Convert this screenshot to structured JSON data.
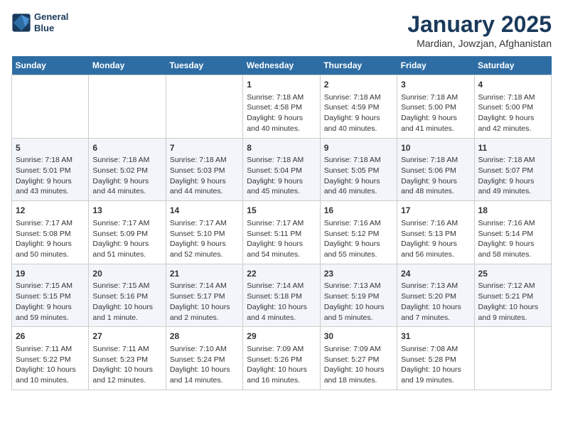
{
  "logo": {
    "line1": "General",
    "line2": "Blue"
  },
  "title": "January 2025",
  "subtitle": "Mardian, Jowzjan, Afghanistan",
  "days_of_week": [
    "Sunday",
    "Monday",
    "Tuesday",
    "Wednesday",
    "Thursday",
    "Friday",
    "Saturday"
  ],
  "weeks": [
    [
      {
        "num": "",
        "info": ""
      },
      {
        "num": "",
        "info": ""
      },
      {
        "num": "",
        "info": ""
      },
      {
        "num": "1",
        "info": "Sunrise: 7:18 AM\nSunset: 4:58 PM\nDaylight: 9 hours and 40 minutes."
      },
      {
        "num": "2",
        "info": "Sunrise: 7:18 AM\nSunset: 4:59 PM\nDaylight: 9 hours and 40 minutes."
      },
      {
        "num": "3",
        "info": "Sunrise: 7:18 AM\nSunset: 5:00 PM\nDaylight: 9 hours and 41 minutes."
      },
      {
        "num": "4",
        "info": "Sunrise: 7:18 AM\nSunset: 5:00 PM\nDaylight: 9 hours and 42 minutes."
      }
    ],
    [
      {
        "num": "5",
        "info": "Sunrise: 7:18 AM\nSunset: 5:01 PM\nDaylight: 9 hours and 43 minutes."
      },
      {
        "num": "6",
        "info": "Sunrise: 7:18 AM\nSunset: 5:02 PM\nDaylight: 9 hours and 44 minutes."
      },
      {
        "num": "7",
        "info": "Sunrise: 7:18 AM\nSunset: 5:03 PM\nDaylight: 9 hours and 44 minutes."
      },
      {
        "num": "8",
        "info": "Sunrise: 7:18 AM\nSunset: 5:04 PM\nDaylight: 9 hours and 45 minutes."
      },
      {
        "num": "9",
        "info": "Sunrise: 7:18 AM\nSunset: 5:05 PM\nDaylight: 9 hours and 46 minutes."
      },
      {
        "num": "10",
        "info": "Sunrise: 7:18 AM\nSunset: 5:06 PM\nDaylight: 9 hours and 48 minutes."
      },
      {
        "num": "11",
        "info": "Sunrise: 7:18 AM\nSunset: 5:07 PM\nDaylight: 9 hours and 49 minutes."
      }
    ],
    [
      {
        "num": "12",
        "info": "Sunrise: 7:17 AM\nSunset: 5:08 PM\nDaylight: 9 hours and 50 minutes."
      },
      {
        "num": "13",
        "info": "Sunrise: 7:17 AM\nSunset: 5:09 PM\nDaylight: 9 hours and 51 minutes."
      },
      {
        "num": "14",
        "info": "Sunrise: 7:17 AM\nSunset: 5:10 PM\nDaylight: 9 hours and 52 minutes."
      },
      {
        "num": "15",
        "info": "Sunrise: 7:17 AM\nSunset: 5:11 PM\nDaylight: 9 hours and 54 minutes."
      },
      {
        "num": "16",
        "info": "Sunrise: 7:16 AM\nSunset: 5:12 PM\nDaylight: 9 hours and 55 minutes."
      },
      {
        "num": "17",
        "info": "Sunrise: 7:16 AM\nSunset: 5:13 PM\nDaylight: 9 hours and 56 minutes."
      },
      {
        "num": "18",
        "info": "Sunrise: 7:16 AM\nSunset: 5:14 PM\nDaylight: 9 hours and 58 minutes."
      }
    ],
    [
      {
        "num": "19",
        "info": "Sunrise: 7:15 AM\nSunset: 5:15 PM\nDaylight: 9 hours and 59 minutes."
      },
      {
        "num": "20",
        "info": "Sunrise: 7:15 AM\nSunset: 5:16 PM\nDaylight: 10 hours and 1 minute."
      },
      {
        "num": "21",
        "info": "Sunrise: 7:14 AM\nSunset: 5:17 PM\nDaylight: 10 hours and 2 minutes."
      },
      {
        "num": "22",
        "info": "Sunrise: 7:14 AM\nSunset: 5:18 PM\nDaylight: 10 hours and 4 minutes."
      },
      {
        "num": "23",
        "info": "Sunrise: 7:13 AM\nSunset: 5:19 PM\nDaylight: 10 hours and 5 minutes."
      },
      {
        "num": "24",
        "info": "Sunrise: 7:13 AM\nSunset: 5:20 PM\nDaylight: 10 hours and 7 minutes."
      },
      {
        "num": "25",
        "info": "Sunrise: 7:12 AM\nSunset: 5:21 PM\nDaylight: 10 hours and 9 minutes."
      }
    ],
    [
      {
        "num": "26",
        "info": "Sunrise: 7:11 AM\nSunset: 5:22 PM\nDaylight: 10 hours and 10 minutes."
      },
      {
        "num": "27",
        "info": "Sunrise: 7:11 AM\nSunset: 5:23 PM\nDaylight: 10 hours and 12 minutes."
      },
      {
        "num": "28",
        "info": "Sunrise: 7:10 AM\nSunset: 5:24 PM\nDaylight: 10 hours and 14 minutes."
      },
      {
        "num": "29",
        "info": "Sunrise: 7:09 AM\nSunset: 5:26 PM\nDaylight: 10 hours and 16 minutes."
      },
      {
        "num": "30",
        "info": "Sunrise: 7:09 AM\nSunset: 5:27 PM\nDaylight: 10 hours and 18 minutes."
      },
      {
        "num": "31",
        "info": "Sunrise: 7:08 AM\nSunset: 5:28 PM\nDaylight: 10 hours and 19 minutes."
      },
      {
        "num": "",
        "info": ""
      }
    ]
  ]
}
